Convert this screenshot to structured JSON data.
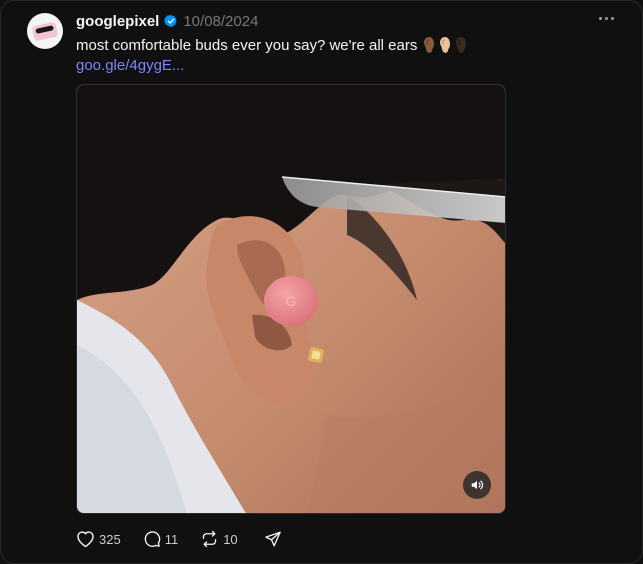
{
  "post": {
    "username": "googlepixel",
    "date": "10/08/2024",
    "text": "most comfortable buds ever you say? we're all ears",
    "text_emojis": [
      "ear-medium-dark",
      "ear-light",
      "ear-dark"
    ],
    "link": "goo.gle/4gygE...",
    "media": {
      "type": "video",
      "subject": "pink earbud in ear",
      "audio_state": "muted-toggle"
    }
  },
  "actions": {
    "likes": "325",
    "replies": "11",
    "reposts": "10"
  },
  "colors": {
    "background": "#101010",
    "text": "#f3f5f7",
    "muted": "#777777",
    "link": "#7f84ff",
    "verified": "#0095f6",
    "earbud": "#e98a8e"
  },
  "icons": {
    "more": "ellipsis-icon",
    "verified": "verified-badge-icon",
    "like": "heart-icon",
    "reply": "speech-bubble-icon",
    "repost": "repost-icon",
    "share": "send-icon",
    "audio": "speaker-icon"
  }
}
